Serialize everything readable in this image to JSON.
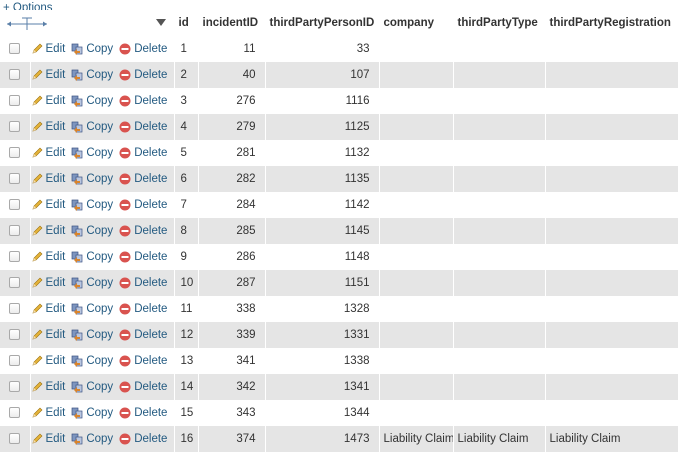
{
  "options_link": "+ Options",
  "colors": {
    "link": "#235a81",
    "row_alt": "#e5e5e5",
    "delete_icon": "#d9534f",
    "edit_icon": "#e6b43a"
  },
  "icons": {
    "edit": "pencil-icon",
    "copy": "copy-icon",
    "delete": "delete-icon",
    "resize": "column-resize-arrows-icon",
    "sort": "sort-triangle-icon"
  },
  "columns": [
    "id",
    "incidentID",
    "thirdPartyPersonID",
    "company",
    "thirdPartyType",
    "thirdPartyRegistration"
  ],
  "actions": {
    "edit": "Edit",
    "copy": "Copy",
    "delete": "Delete"
  },
  "rows": [
    {
      "id": "1",
      "incidentID": "11",
      "thirdPartyPersonID": "33",
      "company": "",
      "thirdPartyType": "",
      "thirdPartyRegistration": ""
    },
    {
      "id": "2",
      "incidentID": "40",
      "thirdPartyPersonID": "107",
      "company": "",
      "thirdPartyType": "",
      "thirdPartyRegistration": ""
    },
    {
      "id": "3",
      "incidentID": "276",
      "thirdPartyPersonID": "1116",
      "company": "",
      "thirdPartyType": "",
      "thirdPartyRegistration": ""
    },
    {
      "id": "4",
      "incidentID": "279",
      "thirdPartyPersonID": "1125",
      "company": "",
      "thirdPartyType": "",
      "thirdPartyRegistration": ""
    },
    {
      "id": "5",
      "incidentID": "281",
      "thirdPartyPersonID": "1132",
      "company": "",
      "thirdPartyType": "",
      "thirdPartyRegistration": ""
    },
    {
      "id": "6",
      "incidentID": "282",
      "thirdPartyPersonID": "1135",
      "company": "",
      "thirdPartyType": "",
      "thirdPartyRegistration": ""
    },
    {
      "id": "7",
      "incidentID": "284",
      "thirdPartyPersonID": "1142",
      "company": "",
      "thirdPartyType": "",
      "thirdPartyRegistration": ""
    },
    {
      "id": "8",
      "incidentID": "285",
      "thirdPartyPersonID": "1145",
      "company": "",
      "thirdPartyType": "",
      "thirdPartyRegistration": ""
    },
    {
      "id": "9",
      "incidentID": "286",
      "thirdPartyPersonID": "1148",
      "company": "",
      "thirdPartyType": "",
      "thirdPartyRegistration": ""
    },
    {
      "id": "10",
      "incidentID": "287",
      "thirdPartyPersonID": "1151",
      "company": "",
      "thirdPartyType": "",
      "thirdPartyRegistration": ""
    },
    {
      "id": "11",
      "incidentID": "338",
      "thirdPartyPersonID": "1328",
      "company": "",
      "thirdPartyType": "",
      "thirdPartyRegistration": ""
    },
    {
      "id": "12",
      "incidentID": "339",
      "thirdPartyPersonID": "1331",
      "company": "",
      "thirdPartyType": "",
      "thirdPartyRegistration": ""
    },
    {
      "id": "13",
      "incidentID": "341",
      "thirdPartyPersonID": "1338",
      "company": "",
      "thirdPartyType": "",
      "thirdPartyRegistration": ""
    },
    {
      "id": "14",
      "incidentID": "342",
      "thirdPartyPersonID": "1341",
      "company": "",
      "thirdPartyType": "",
      "thirdPartyRegistration": ""
    },
    {
      "id": "15",
      "incidentID": "343",
      "thirdPartyPersonID": "1344",
      "company": "",
      "thirdPartyType": "",
      "thirdPartyRegistration": ""
    },
    {
      "id": "16",
      "incidentID": "374",
      "thirdPartyPersonID": "1473",
      "company": "Liability Claim",
      "thirdPartyType": "Liability Claim",
      "thirdPartyRegistration": "Liability Claim"
    }
  ]
}
